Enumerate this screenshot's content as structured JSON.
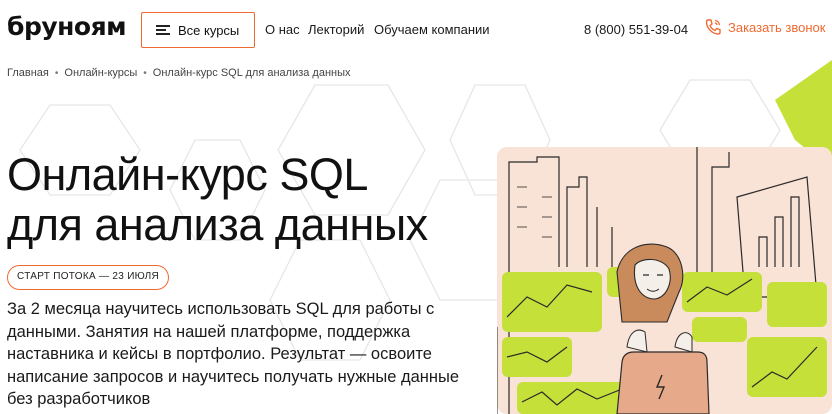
{
  "header": {
    "logo": "бруноям",
    "all_courses_label": "Все курсы",
    "nav": [
      "О нас",
      "Лекторий",
      "Обучаем компании"
    ],
    "phone": "8 (800) 551-39-04",
    "callback_label": "Заказать звонок"
  },
  "breadcrumb": [
    "Главная",
    "Онлайн-курсы",
    "Онлайн-курс SQL для анализа данных"
  ],
  "hero": {
    "title_line1": "Онлайн-курс SQL",
    "title_line2": "для анализа данных",
    "badge": "СТАРТ ПОТОКА — 23 ИЮЛЯ",
    "description": "За 2 месяца научитесь использовать SQL для работы с данными. Занятия на нашей платформе, поддержка наставника и кейсы в портфолио. Результат — освоите написание запросов и научитесь получать нужные данные без разработчиков"
  },
  "colors": {
    "accent": "#f06a30",
    "lime": "#c6e03a",
    "peach": "#f7d3c2"
  },
  "icons": [
    "burger-menu-icon",
    "phone-icon",
    "chevron-right-icon"
  ]
}
